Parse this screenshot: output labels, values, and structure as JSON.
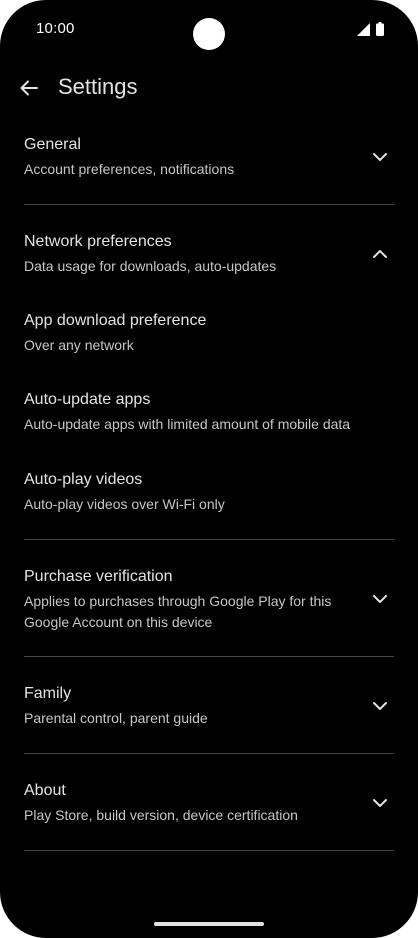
{
  "status_bar": {
    "time": "10:00",
    "icons": [
      "signal-icon",
      "battery-icon"
    ]
  },
  "app_bar": {
    "back_icon": "arrow-back-icon",
    "title": "Settings"
  },
  "sections": {
    "general": {
      "title": "General",
      "subtitle": "Account preferences, notifications",
      "icon": "chevron-down-icon"
    },
    "network": {
      "title": "Network preferences",
      "subtitle": "Data usage for downloads, auto-updates",
      "icon": "chevron-up-icon",
      "items": [
        {
          "title": "App download preference",
          "subtitle": "Over any network"
        },
        {
          "title": "Auto-update apps",
          "subtitle": "Auto-update apps with limited amount of mobile data"
        },
        {
          "title": "Auto-play videos",
          "subtitle": "Auto-play videos over Wi-Fi only"
        }
      ]
    },
    "purchase": {
      "title": "Purchase verification",
      "subtitle_line1": "Applies to purchases through Google Play for this",
      "subtitle_line2": "Google Account on this device",
      "icon": "chevron-down-icon"
    },
    "family": {
      "title": "Family",
      "subtitle": "Parental control, parent guide",
      "icon": "chevron-down-icon"
    },
    "about": {
      "title": "About",
      "subtitle": "Play Store, build version, device certification",
      "icon": "chevron-down-icon"
    }
  },
  "colors": {
    "background": "#000000",
    "text_primary": "#e3e3e3",
    "text_secondary": "#c4c7c5",
    "divider": "#444746"
  }
}
